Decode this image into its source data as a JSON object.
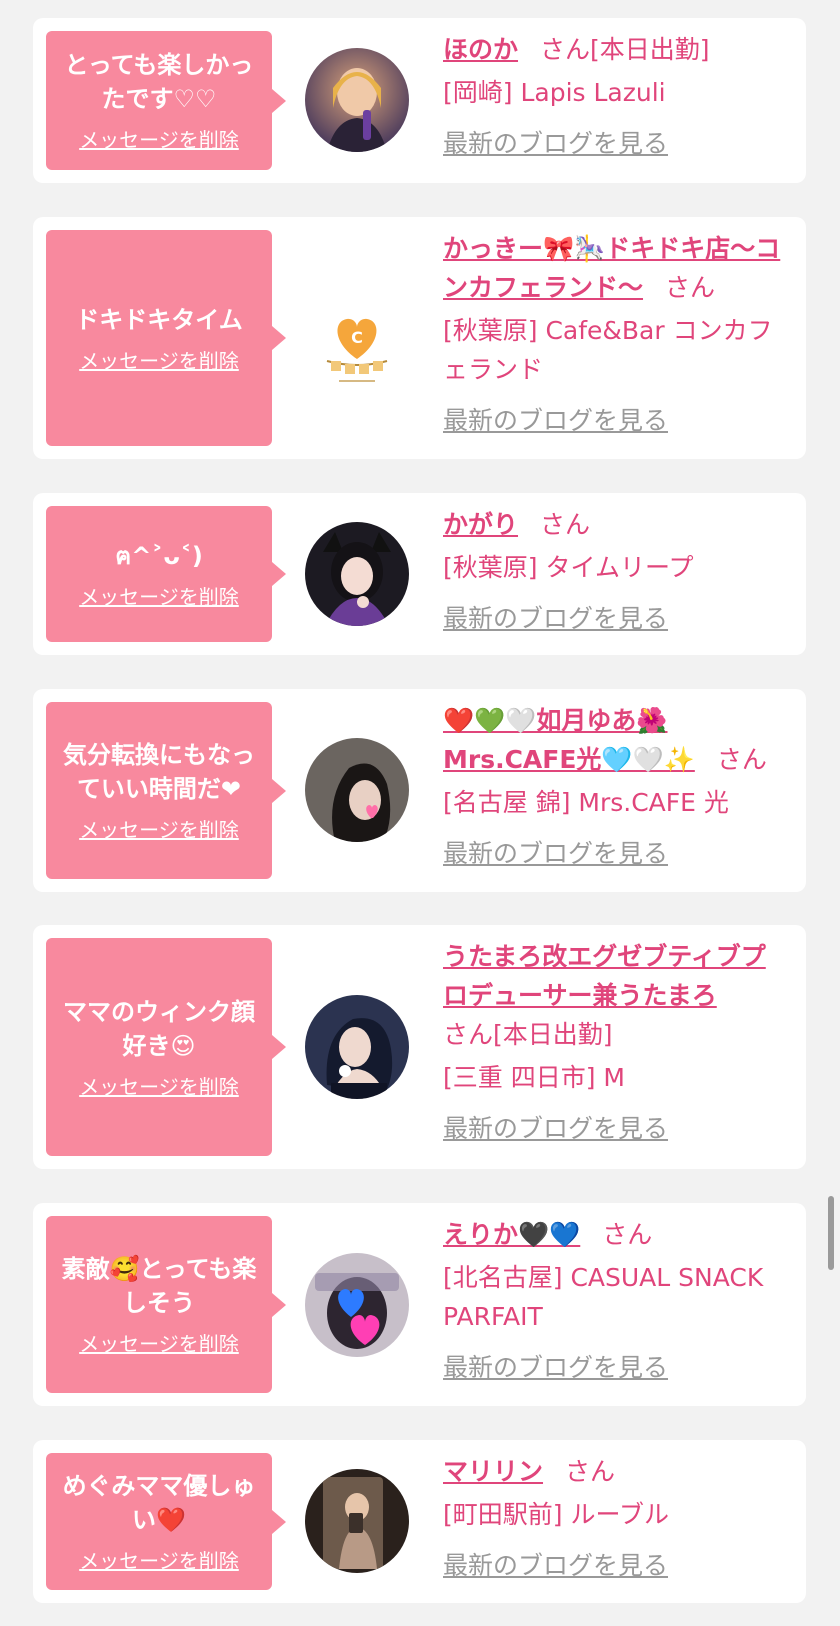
{
  "entries": [
    {
      "message": "とっても楽しかったです♡♡",
      "delete_label": "メッセージを削除",
      "name": "ほのか",
      "san": "さん",
      "status": "[本日出勤]",
      "shop": "[岡崎] Lapis Lazuli",
      "blog_label": "最新のブログを見る",
      "avatar_icon": "profile-photo"
    },
    {
      "message": "ドキドキタイム",
      "delete_label": "メッセージを削除",
      "name": "かっきー🎀🎠ドキドキ店〜コンカフェランド〜",
      "san": "さん",
      "status": "",
      "shop": "[秋葉原] Cafe&Bar コンカフェランド",
      "blog_label": "最新のブログを見る",
      "avatar_icon": "shop-logo"
    },
    {
      "message": "ฅ^˃ᴗ˂)",
      "delete_label": "メッセージを削除",
      "name": "かがり",
      "san": "さん",
      "status": "",
      "shop": "[秋葉原] タイムリープ",
      "blog_label": "最新のブログを見る",
      "avatar_icon": "profile-photo"
    },
    {
      "message": "気分転換にもなっていい時間だ❤︎",
      "delete_label": "メッセージを削除",
      "name": "❤️💚🤍如月ゆあ🌺Mrs.CAFE光🩵🤍✨",
      "san": "さん",
      "status": "",
      "shop": "[名古屋 錦] Mrs.CAFE 光",
      "blog_label": "最新のブログを見る",
      "avatar_icon": "profile-photo"
    },
    {
      "message": "ママのウィンク顔好き😍",
      "delete_label": "メッセージを削除",
      "name": "うたまろ改エグゼブティブプロデューサー兼うたまろ",
      "san": "さん",
      "status": "[本日出勤]",
      "shop": "[三重 四日市] M",
      "blog_label": "最新のブログを見る",
      "avatar_icon": "profile-photo"
    },
    {
      "message": "素敵🥰とっても楽しそう",
      "delete_label": "メッセージを削除",
      "name": "えりか🖤💙",
      "san": "さん",
      "status": "",
      "shop": "[北名古屋] CASUAL SNACK PARFAIT",
      "blog_label": "最新のブログを見る",
      "avatar_icon": "profile-photo"
    },
    {
      "message": "めぐみママ優しゅい❤️",
      "delete_label": "メッセージを削除",
      "name": "マリリン",
      "san": "さん",
      "status": "",
      "shop": "[町田駅前] ルーブル",
      "blog_label": "最新のブログを見る",
      "avatar_icon": "profile-photo"
    }
  ],
  "avatar_logo_text": "C",
  "colors": {
    "accent": "#e0457b",
    "bubble": "#f8899e",
    "muted": "#999999",
    "background": "#f2f2f2"
  }
}
